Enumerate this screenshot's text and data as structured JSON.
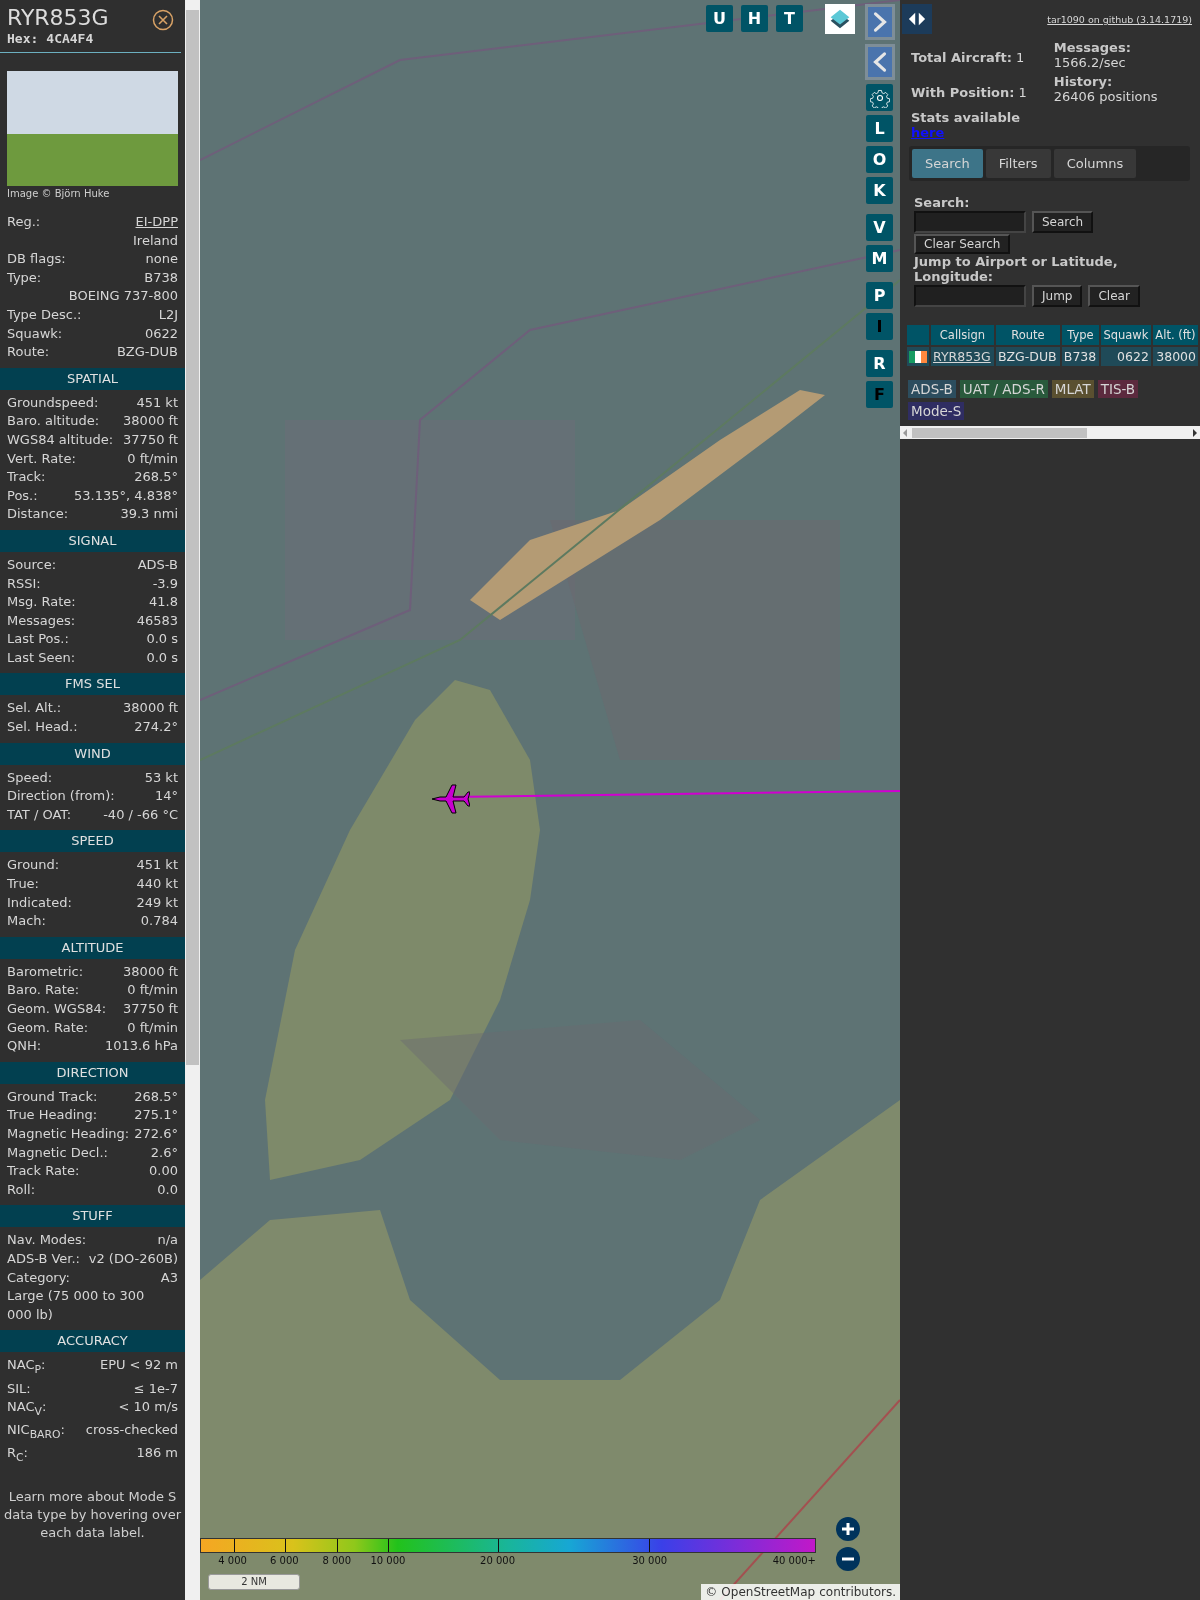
{
  "aircraft": {
    "callsign": "RYR853G",
    "hex_label": "Hex:",
    "hex": "4CA4F4",
    "photo_credit": "Image © Björn Huke"
  },
  "details": [
    {
      "kind": "link",
      "label": "Reg.:",
      "value": "EI-DPP"
    },
    {
      "kind": "value",
      "value": "Ireland"
    },
    {
      "kind": "pair",
      "label": "DB flags:",
      "value": "none"
    },
    {
      "kind": "pair",
      "label": "Type:",
      "value": "B738"
    },
    {
      "kind": "value",
      "value": "BOEING 737-800"
    },
    {
      "kind": "pair",
      "label": "Type Desc.:",
      "value": "L2J"
    },
    {
      "kind": "pair",
      "label": "Squawk:",
      "value": "0622"
    },
    {
      "kind": "pair",
      "label": "Route:",
      "value": "BZG-DUB"
    }
  ],
  "sections": [
    {
      "title": "SPATIAL",
      "rows": [
        {
          "kind": "pair",
          "label": "Groundspeed:",
          "value": "451 kt"
        },
        {
          "kind": "pair",
          "label": "Baro. altitude:",
          "value": "38000 ft"
        },
        {
          "kind": "pair",
          "label": "WGS84 altitude:",
          "value": "37750 ft"
        },
        {
          "kind": "pair",
          "label": "Vert. Rate:",
          "value": "0 ft/min"
        },
        {
          "kind": "pair",
          "label": "Track:",
          "value": "268.5°"
        },
        {
          "kind": "pair",
          "label": "Pos.:",
          "value": "53.135°, 4.838°"
        },
        {
          "kind": "pair",
          "label": "Distance:",
          "value": "39.3 nmi"
        }
      ]
    },
    {
      "title": "SIGNAL",
      "rows": [
        {
          "kind": "pair",
          "label": "Source:",
          "value": "ADS-B"
        },
        {
          "kind": "pair",
          "label": "RSSI:",
          "value": "-3.9"
        },
        {
          "kind": "pair",
          "label": "Msg. Rate:",
          "value": "41.8"
        },
        {
          "kind": "pair",
          "label": "Messages:",
          "value": "46583"
        },
        {
          "kind": "pair",
          "label": "Last Pos.:",
          "value": "0.0 s"
        },
        {
          "kind": "pair",
          "label": "Last Seen:",
          "value": "0.0 s"
        }
      ]
    },
    {
      "title": "FMS SEL",
      "rows": [
        {
          "kind": "pair",
          "label": "Sel. Alt.:",
          "value": "38000 ft"
        },
        {
          "kind": "pair",
          "label": "Sel. Head.:",
          "value": "274.2°"
        }
      ]
    },
    {
      "title": "WIND",
      "rows": [
        {
          "kind": "pair",
          "label": "Speed:",
          "value": "53 kt"
        },
        {
          "kind": "pair",
          "label": "Direction (from):",
          "value": "14°"
        },
        {
          "kind": "pair",
          "label": "TAT / OAT:",
          "value": "-40 / -66 °C"
        }
      ]
    },
    {
      "title": "SPEED",
      "rows": [
        {
          "kind": "pair",
          "label": "Ground:",
          "value": "451 kt"
        },
        {
          "kind": "pair",
          "label": "True:",
          "value": "440 kt"
        },
        {
          "kind": "pair",
          "label": "Indicated:",
          "value": "249 kt"
        },
        {
          "kind": "pair",
          "label": "Mach:",
          "value": "0.784"
        }
      ]
    },
    {
      "title": "ALTITUDE",
      "rows": [
        {
          "kind": "pair",
          "label": "Barometric:",
          "value": "38000 ft"
        },
        {
          "kind": "pair",
          "label": "Baro. Rate:",
          "value": "0 ft/min"
        },
        {
          "kind": "pair",
          "label": "Geom. WGS84:",
          "value": "37750 ft"
        },
        {
          "kind": "pair",
          "label": "Geom. Rate:",
          "value": "0 ft/min"
        },
        {
          "kind": "pair",
          "label": "QNH:",
          "value": "1013.6 hPa"
        }
      ]
    },
    {
      "title": "DIRECTION",
      "rows": [
        {
          "kind": "pair",
          "label": "Ground Track:",
          "value": "268.5°"
        },
        {
          "kind": "pair",
          "label": "True Heading:",
          "value": "275.1°"
        },
        {
          "kind": "pair",
          "label": "Magnetic Heading:",
          "value": "272.6°"
        },
        {
          "kind": "pair",
          "label": "Magnetic Decl.:",
          "value": "2.6°"
        },
        {
          "kind": "pair",
          "label": "Track Rate:",
          "value": "0.00"
        },
        {
          "kind": "pair",
          "label": "Roll:",
          "value": "0.0"
        }
      ]
    },
    {
      "title": "STUFF",
      "rows": [
        {
          "kind": "pair",
          "label": "Nav. Modes:",
          "value": "n/a"
        },
        {
          "kind": "pair",
          "label": "ADS-B Ver.:",
          "value": "v2 (DO-260B)"
        },
        {
          "kind": "pair",
          "label": "Category:",
          "value": "A3"
        },
        {
          "kind": "text",
          "value": "Large (75 000 to 300 000 lb)"
        }
      ]
    },
    {
      "title": "ACCURACY",
      "rows": [
        {
          "kind": "pair",
          "label": "NAC$_{P}$:",
          "value": "EPU < 92 m"
        },
        {
          "kind": "pair",
          "label": "SIL:",
          "value": "≤ 1e-7"
        },
        {
          "kind": "pair",
          "label": "NAC$_{V}$:",
          "value": "< 10 m/s"
        },
        {
          "kind": "pair",
          "label": "NIC$_{BARO}$:",
          "value": "cross-checked"
        },
        {
          "kind": "pair",
          "label": "R$_{C}$:",
          "value": "186 m"
        }
      ]
    }
  ],
  "footer_note": "Learn more about Mode S data type by hovering over each data label.",
  "map": {
    "top_buttons": [
      {
        "label": "U",
        "active": true
      },
      {
        "label": "H",
        "active": true
      },
      {
        "label": "T",
        "active": true
      }
    ],
    "side_buttons": [
      {
        "kind": "next"
      },
      {
        "kind": "prev"
      },
      {
        "kind": "gear"
      },
      {
        "kind": "letter",
        "label": "L",
        "active": true
      },
      {
        "kind": "letter",
        "label": "O",
        "active": true
      },
      {
        "kind": "letter",
        "label": "K",
        "active": true
      },
      {
        "kind": "letter",
        "label": "V",
        "active": true
      },
      {
        "kind": "letter",
        "label": "M",
        "active": true
      },
      {
        "kind": "letter",
        "label": "P",
        "active": true
      },
      {
        "kind": "letter",
        "label": "I",
        "active": false
      },
      {
        "kind": "letter",
        "label": "R",
        "active": true
      },
      {
        "kind": "letter",
        "label": "F",
        "active": false
      }
    ],
    "altitude_legend": [
      "4 000",
      "6 000",
      "8 000",
      "10 000",
      "20 000",
      "30 000",
      "40 000+"
    ],
    "scale": "2 NM",
    "attribution": {
      "prefix": "©",
      "link": "OpenStreetMap",
      "suffix": "contributors."
    }
  },
  "sidebar": {
    "version_link": "tar1090 on github (3.14.1719)",
    "stats_left": [
      {
        "label": "Total Aircraft:",
        "value": "1"
      },
      {
        "label": "With Position:",
        "value": "1"
      }
    ],
    "stats_right": [
      {
        "label": "Messages:",
        "value": "1566.2/sec"
      },
      {
        "label": "History:",
        "value": "26406 positions"
      }
    ],
    "stats_link": {
      "label": "Stats available",
      "link": "here"
    },
    "tabs": [
      {
        "label": "Search",
        "selected": true
      },
      {
        "label": "Filters",
        "selected": false
      },
      {
        "label": "Columns",
        "selected": false
      }
    ],
    "search": {
      "label": "Search:",
      "button": "Search",
      "clear_button": "Clear Search",
      "jump_label": "Jump to Airport or Latitude, Longitude:",
      "jump_button": "Jump",
      "jump_clear": "Clear"
    },
    "table": {
      "columns": [
        "Callsign",
        "Route",
        "Type",
        "Squawk",
        "Alt. (ft)"
      ],
      "rows": [
        {
          "callsign": "RYR853G",
          "route": "BZG-DUB",
          "type": "B738",
          "squawk": "0622",
          "altitude": "38000"
        }
      ]
    },
    "legend": [
      {
        "label": "ADS-B",
        "color": "#2c4d5e"
      },
      {
        "label": "UAT / ADS-R",
        "color": "#295a3c"
      },
      {
        "label": "MLAT",
        "color": "#5a5030"
      },
      {
        "label": "TIS-B",
        "color": "#5c2a3e"
      },
      {
        "label": "Mode-S",
        "color": "#2f2d62"
      }
    ]
  }
}
